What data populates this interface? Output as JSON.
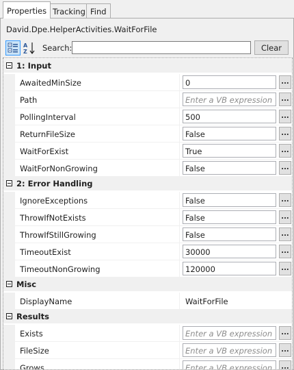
{
  "tabs": [
    {
      "label": "Properties"
    },
    {
      "label": "Tracking"
    },
    {
      "label": "Find"
    }
  ],
  "object_name": "David.Dpe.HelperActivities.WaitForFile",
  "toolbar": {
    "categorized_icon": "categorized-view-icon",
    "alphabetical_icon": "sort-alphabetical-icon",
    "search_label": "Search:",
    "search_value": "",
    "clear_label": "Clear"
  },
  "ellipsis_label": "...",
  "categories": [
    {
      "label": "1: Input",
      "rows": [
        {
          "name": "AwaitedMinSize",
          "value": "0",
          "placeholder": false
        },
        {
          "name": "Path",
          "value": "Enter a VB expression",
          "placeholder": true
        },
        {
          "name": "PollingInterval",
          "value": "500",
          "placeholder": false
        },
        {
          "name": "ReturnFileSize",
          "value": "False",
          "placeholder": false
        },
        {
          "name": "WaitForExist",
          "value": "True",
          "placeholder": false
        },
        {
          "name": "WaitForNonGrowing",
          "value": "False",
          "placeholder": false
        }
      ]
    },
    {
      "label": "2: Error Handling",
      "rows": [
        {
          "name": "IgnoreExceptions",
          "value": "False",
          "placeholder": false
        },
        {
          "name": "ThrowIfNotExists",
          "value": "False",
          "placeholder": false
        },
        {
          "name": "ThrowIfStillGrowing",
          "value": "False",
          "placeholder": false
        },
        {
          "name": "TimeoutExist",
          "value": "30000",
          "placeholder": false
        },
        {
          "name": "TimeoutNonGrowing",
          "value": "120000",
          "placeholder": false
        }
      ]
    },
    {
      "label": "Misc",
      "rows": [
        {
          "name": "DisplayName",
          "value": "WaitForFile",
          "placeholder": false
        }
      ]
    },
    {
      "label": "Results",
      "rows": [
        {
          "name": "Exists",
          "value": "Enter a VB expression",
          "placeholder": true
        },
        {
          "name": "FileSize",
          "value": "Enter a VB expression",
          "placeholder": true
        },
        {
          "name": "Grows",
          "value": "Enter a VB expression",
          "placeholder": true
        }
      ]
    }
  ]
}
